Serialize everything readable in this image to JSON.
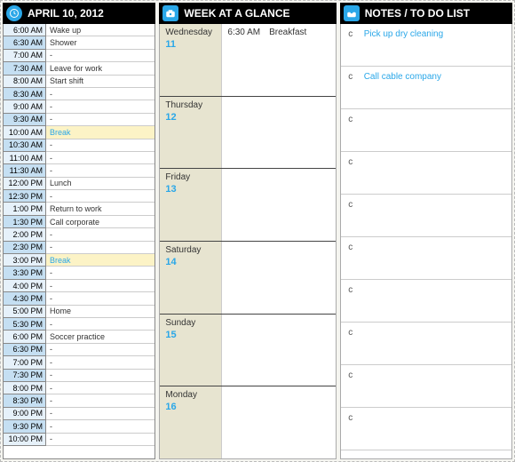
{
  "header": {
    "date_title": "APRIL 10, 2012",
    "week_title": "WEEK AT A GLANCE",
    "notes_title": "NOTES / TO DO LIST"
  },
  "schedule": [
    {
      "time": "6:00 AM",
      "event": "Wake up"
    },
    {
      "time": "6:30 AM",
      "event": "Shower"
    },
    {
      "time": "7:00 AM",
      "event": "-"
    },
    {
      "time": "7:30 AM",
      "event": "Leave for work"
    },
    {
      "time": "8:00 AM",
      "event": "Start shift"
    },
    {
      "time": "8:30 AM",
      "event": "-"
    },
    {
      "time": "9:00 AM",
      "event": "-"
    },
    {
      "time": "9:30 AM",
      "event": "-"
    },
    {
      "time": "10:00 AM",
      "event": "Break",
      "highlight": true
    },
    {
      "time": "10:30 AM",
      "event": "-"
    },
    {
      "time": "11:00 AM",
      "event": "-"
    },
    {
      "time": "11:30 AM",
      "event": "-"
    },
    {
      "time": "12:00 PM",
      "event": "Lunch"
    },
    {
      "time": "12:30 PM",
      "event": "-"
    },
    {
      "time": "1:00 PM",
      "event": "Return to work"
    },
    {
      "time": "1:30 PM",
      "event": "Call corporate"
    },
    {
      "time": "2:00 PM",
      "event": "-"
    },
    {
      "time": "2:30 PM",
      "event": "-"
    },
    {
      "time": "3:00 PM",
      "event": "Break",
      "highlight": true
    },
    {
      "time": "3:30 PM",
      "event": "-"
    },
    {
      "time": "4:00 PM",
      "event": "-"
    },
    {
      "time": "4:30 PM",
      "event": "-"
    },
    {
      "time": "5:00 PM",
      "event": "Home"
    },
    {
      "time": "5:30 PM",
      "event": "-"
    },
    {
      "time": "6:00 PM",
      "event": "Soccer practice"
    },
    {
      "time": "6:30 PM",
      "event": "-"
    },
    {
      "time": "7:00 PM",
      "event": "-"
    },
    {
      "time": "7:30 PM",
      "event": "-"
    },
    {
      "time": "8:00 PM",
      "event": "-"
    },
    {
      "time": "8:30 PM",
      "event": "-"
    },
    {
      "time": "9:00 PM",
      "event": "-"
    },
    {
      "time": "9:30 PM",
      "event": "-"
    },
    {
      "time": "10:00 PM",
      "event": "-"
    }
  ],
  "week": [
    {
      "day": "Wednesday",
      "num": "11",
      "events": [
        {
          "time": "6:30 AM",
          "label": "Breakfast"
        }
      ]
    },
    {
      "day": "Thursday",
      "num": "12",
      "events": []
    },
    {
      "day": "Friday",
      "num": "13",
      "events": []
    },
    {
      "day": "Saturday",
      "num": "14",
      "events": []
    },
    {
      "day": "Sunday",
      "num": "15",
      "events": []
    },
    {
      "day": "Monday",
      "num": "16",
      "events": []
    }
  ],
  "notes": [
    {
      "mark": "c",
      "text": "Pick up dry cleaning"
    },
    {
      "mark": "c",
      "text": "Call cable company"
    },
    {
      "mark": "c",
      "text": ""
    },
    {
      "mark": "c",
      "text": ""
    },
    {
      "mark": "c",
      "text": ""
    },
    {
      "mark": "c",
      "text": ""
    },
    {
      "mark": "c",
      "text": ""
    },
    {
      "mark": "c",
      "text": ""
    },
    {
      "mark": "c",
      "text": ""
    },
    {
      "mark": "c",
      "text": ""
    }
  ]
}
